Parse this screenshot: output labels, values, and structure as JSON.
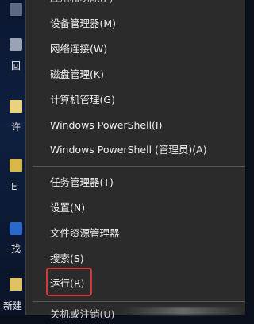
{
  "desktop": {
    "labels": {
      "recycle": "回",
      "license": "许",
      "e": "E",
      "task": "找",
      "new": "新建"
    }
  },
  "menu": {
    "items": [
      {
        "label": "应用和功能(F)"
      },
      {
        "label": "设备管理器(M)"
      },
      {
        "label": "网络连接(W)"
      },
      {
        "label": "磁盘管理(K)"
      },
      {
        "label": "计算机管理(G)"
      },
      {
        "label": "Windows PowerShell(I)"
      },
      {
        "label": "Windows PowerShell (管理员)(A)"
      },
      {
        "label": "任务管理器(T)"
      },
      {
        "label": "设置(N)"
      },
      {
        "label": "文件资源管理器"
      },
      {
        "label": "搜索(S)"
      },
      {
        "label": "运行(R)"
      },
      {
        "label": "关机或注销(U)"
      }
    ],
    "highlight_color": "#d23a3a"
  }
}
